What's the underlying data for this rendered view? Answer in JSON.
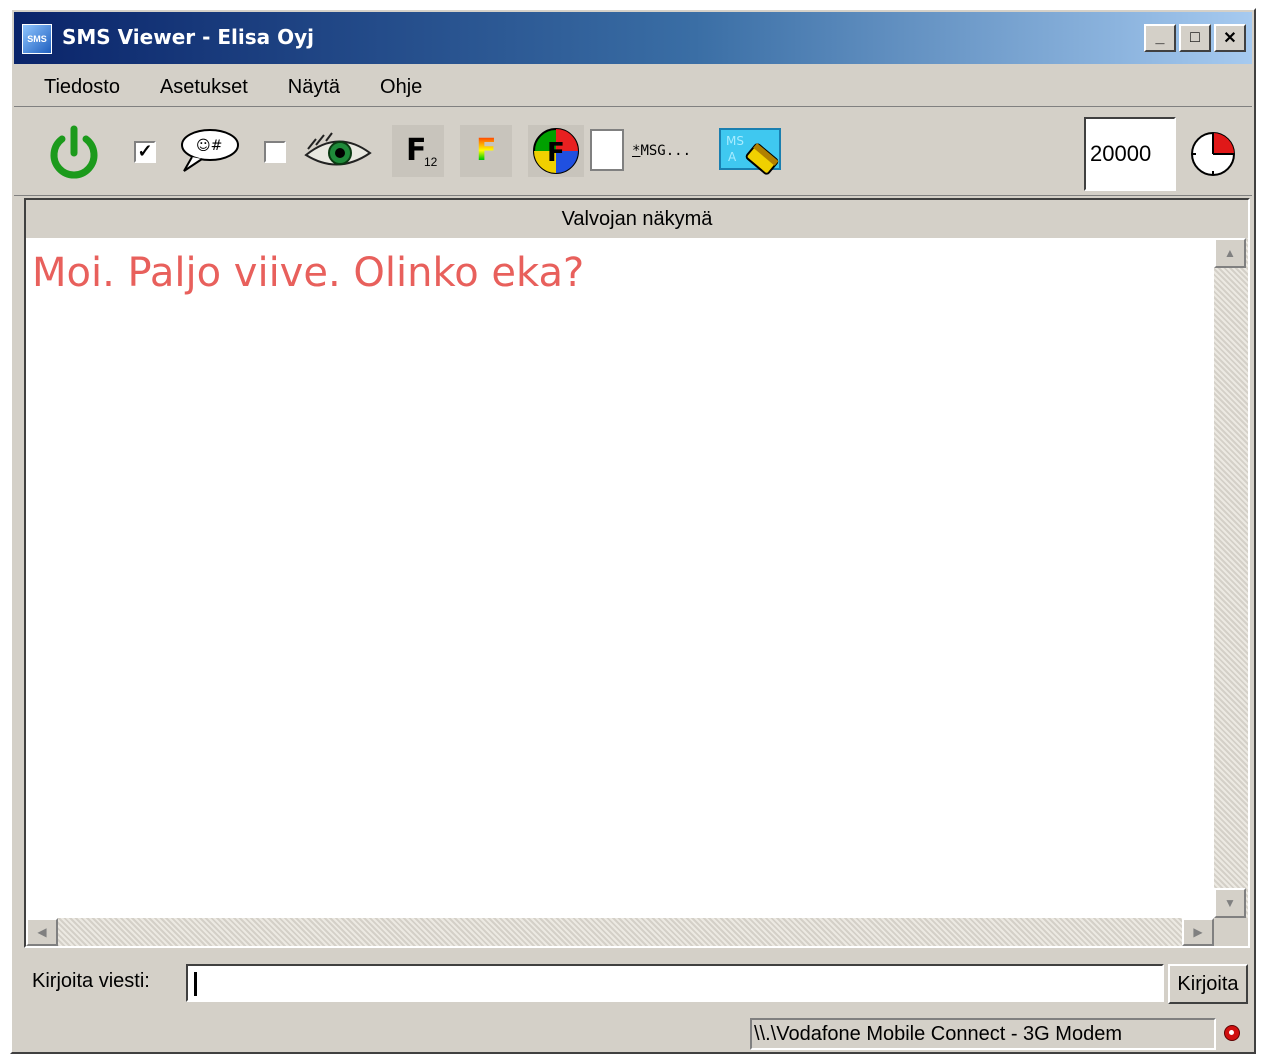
{
  "window": {
    "title": "SMS Viewer - Elisa Oyj",
    "app_icon_text": "SMS",
    "controls": {
      "minimize": "_",
      "maximize": "□",
      "close": "✕"
    }
  },
  "menu": [
    "Tiedosto",
    "Asetukset",
    "Näytä",
    "Ohje"
  ],
  "toolbar": {
    "power_icon": "power-icon",
    "checkbox1_checked": true,
    "checkbox1_mark": "✓",
    "checkbox2_checked": false,
    "font_button_label": "F",
    "font_button_sub": "12",
    "color_font_label": "F",
    "msg_label": "MSG...",
    "msg_prefix": "*",
    "msa_label": "MS A",
    "timeout_value": "20000"
  },
  "panel": {
    "header": "Valvojan näkymä",
    "message": "Moi. Paljo viive. Olinko eka?",
    "message_color": "#e8605c"
  },
  "input": {
    "label": "Kirjoita viesti:",
    "value": "",
    "button_label": "Kirjoita"
  },
  "status": {
    "connection": "\\\\.\\Vodafone Mobile Connect - 3G Modem",
    "indicator_color": "#d01010"
  }
}
